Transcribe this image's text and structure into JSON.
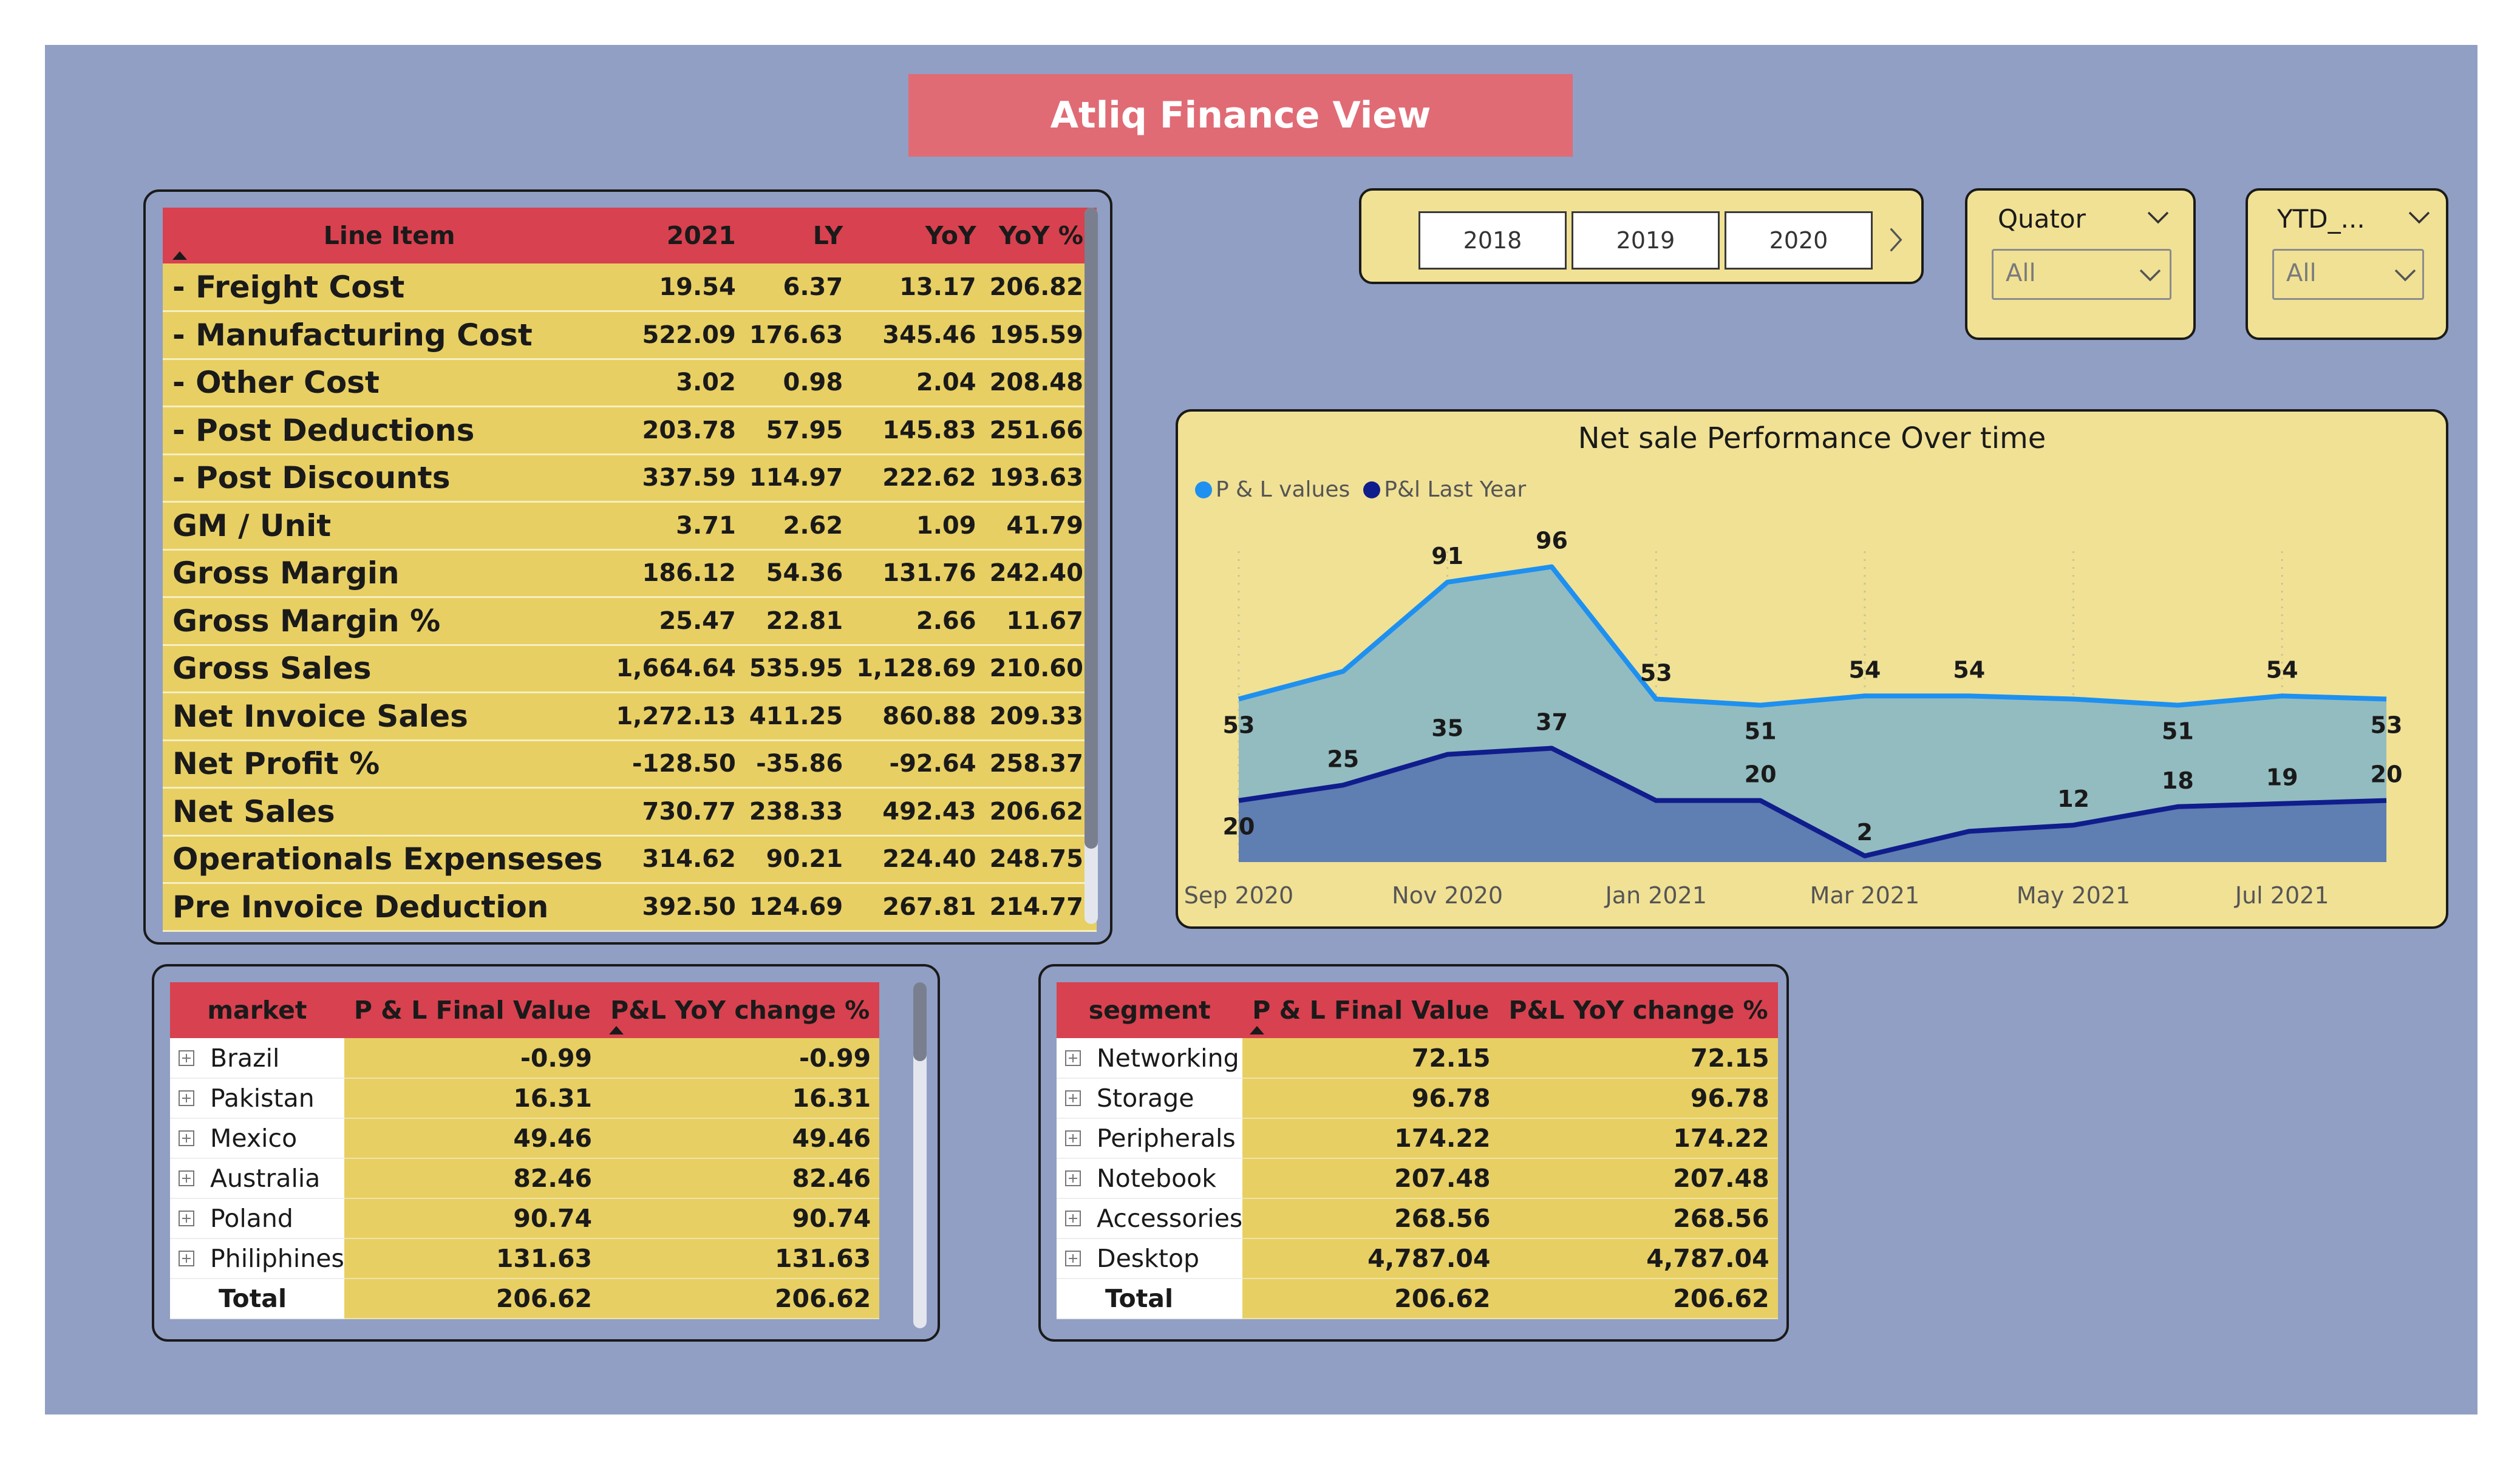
{
  "title": "Atliq Finance View",
  "colors": {
    "background": "#919fc4",
    "header_red": "#d8414f",
    "cell_yellow": "#e8cf63",
    "panel_yellow": "#f0e195",
    "title_pink": "#e06b75",
    "line_current": "#1e90f0",
    "line_last_year": "#101d8c"
  },
  "pl_table": {
    "headers": [
      "Line Item",
      "2021",
      "LY",
      "YoY",
      "YoY %"
    ],
    "rows": [
      [
        "- Freight Cost",
        "19.54",
        "6.37",
        "13.17",
        "206.82"
      ],
      [
        "- Manufacturing Cost",
        "522.09",
        "176.63",
        "345.46",
        "195.59"
      ],
      [
        "- Other Cost",
        "3.02",
        "0.98",
        "2.04",
        "208.48"
      ],
      [
        "- Post Deductions",
        "203.78",
        "57.95",
        "145.83",
        "251.66"
      ],
      [
        "- Post Discounts",
        "337.59",
        "114.97",
        "222.62",
        "193.63"
      ],
      [
        "GM / Unit",
        "3.71",
        "2.62",
        "1.09",
        "41.79"
      ],
      [
        "Gross Margin",
        "186.12",
        "54.36",
        "131.76",
        "242.40"
      ],
      [
        "Gross Margin %",
        "25.47",
        "22.81",
        "2.66",
        "11.67"
      ],
      [
        "Gross Sales",
        "1,664.64",
        "535.95",
        "1,128.69",
        "210.60"
      ],
      [
        "Net Invoice Sales",
        "1,272.13",
        "411.25",
        "860.88",
        "209.33"
      ],
      [
        "Net Profit %",
        "-128.50",
        "-35.86",
        "-92.64",
        "258.37"
      ],
      [
        "Net Sales",
        "730.77",
        "238.33",
        "492.43",
        "206.62"
      ],
      [
        "Operationals Expenseses",
        "314.62",
        "90.21",
        "224.40",
        "248.75"
      ],
      [
        "Pre Invoice Deduction",
        "392.50",
        "124.69",
        "267.81",
        "214.77"
      ]
    ]
  },
  "year_slicer": {
    "years": [
      "2018",
      "2019",
      "2020"
    ]
  },
  "quator_slicer": {
    "label": "Quator",
    "value": "All"
  },
  "ytd_slicer": {
    "label": "YTD_...",
    "value": "All"
  },
  "chart_data": {
    "type": "area",
    "title": "Net sale Performance Over time",
    "x": [
      "Sep 2020",
      "Oct 2020",
      "Nov 2020",
      "Dec 2020",
      "Jan 2021",
      "Feb 2021",
      "Mar 2021",
      "Apr 2021",
      "May 2021",
      "Jun 2021",
      "Jul 2021",
      "Aug 2021"
    ],
    "x_tick_labels": [
      "Sep 2020",
      "Nov 2020",
      "Jan 2021",
      "Mar 2021",
      "May 2021",
      "Jul 2021"
    ],
    "series": [
      {
        "name": "P & L values",
        "values": [
          53,
          62,
          91,
          96,
          53,
          51,
          54,
          54,
          53,
          51,
          54,
          53
        ],
        "labels": [
          "53",
          "",
          "91",
          "96",
          "53",
          "51",
          "54",
          "54",
          "",
          "51",
          "54",
          "53"
        ]
      },
      {
        "name": "P&l Last Year",
        "values": [
          20,
          25,
          35,
          37,
          20,
          20,
          2,
          10,
          12,
          18,
          19,
          20
        ],
        "labels": [
          "20",
          "25",
          "35",
          "37",
          "",
          "20",
          "2",
          "",
          "12",
          "18",
          "19",
          "20"
        ]
      }
    ],
    "ylim": [
      0,
      105
    ],
    "legend": "top-left",
    "grid": false
  },
  "market_table": {
    "headers": [
      "market",
      "P & L Final Value",
      "P&L YoY change %"
    ],
    "rows": [
      [
        "Brazil",
        "-0.99",
        "-0.99"
      ],
      [
        "Pakistan",
        "16.31",
        "16.31"
      ],
      [
        "Mexico",
        "49.46",
        "49.46"
      ],
      [
        "Australia",
        "82.46",
        "82.46"
      ],
      [
        "Poland",
        "90.74",
        "90.74"
      ],
      [
        "Philiphines",
        "131.63",
        "131.63"
      ]
    ],
    "total": [
      "Total",
      "206.62",
      "206.62"
    ]
  },
  "segment_table": {
    "headers": [
      "segment",
      "P & L Final Value",
      "P&L YoY change %"
    ],
    "rows": [
      [
        "Networking",
        "72.15",
        "72.15"
      ],
      [
        "Storage",
        "96.78",
        "96.78"
      ],
      [
        "Peripherals",
        "174.22",
        "174.22"
      ],
      [
        "Notebook",
        "207.48",
        "207.48"
      ],
      [
        "Accessories",
        "268.56",
        "268.56"
      ],
      [
        "Desktop",
        "4,787.04",
        "4,787.04"
      ]
    ],
    "total": [
      "Total",
      "206.62",
      "206.62"
    ]
  }
}
